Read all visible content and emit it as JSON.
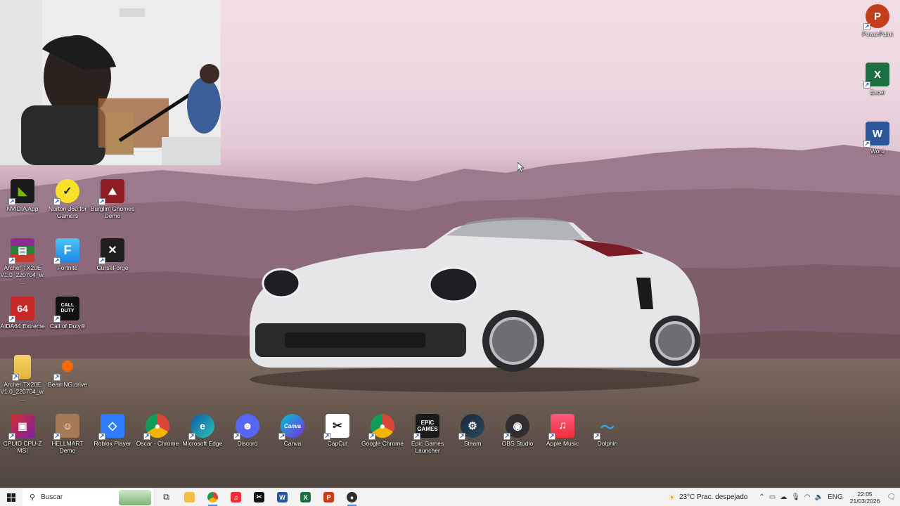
{
  "desktop_icons": {
    "nvidia": "NVIDIA App",
    "norton": "Norton 360 for Gamers",
    "burglin": "Burglin' Gnomes Demo",
    "archer1": "Archer TX20E V1.0_220704_w...",
    "fortnite": "Fortnite",
    "curseforge": "CurseForge",
    "aida64": "AIDA64 Extreme",
    "callofduty": "Call of Duty®",
    "archer2": "Archer TX20E V1.0_220704_w...",
    "beamng": "BeamNG.drive",
    "cpuid": "CPUID CPU-Z MSI",
    "hellmart": "HELLMART Demo",
    "roblox": "Roblox Player",
    "oscar": "Oscar - Chrome",
    "edge": "Microsoft Edge",
    "discord": "Discord",
    "canva": "Canva",
    "capcut": "CapCut",
    "chrome": "Google Chrome",
    "epic": "Epic Games Launcher",
    "steam": "Steam",
    "obs": "OBS Studio",
    "applemusic": "Apple Music",
    "dolphin": "Dolphin",
    "powerpoint": "PowerPoint",
    "excel": "Excel",
    "word": "Word"
  },
  "taskbar": {
    "search_placeholder": "Buscar",
    "weather": "23°C  Prac. despejado",
    "language": "ENG",
    "time": "22:05",
    "date": "21/03/2026"
  },
  "colors": {
    "taskbar_bg": "#f3f3f3",
    "accent": "#4a90e2"
  }
}
